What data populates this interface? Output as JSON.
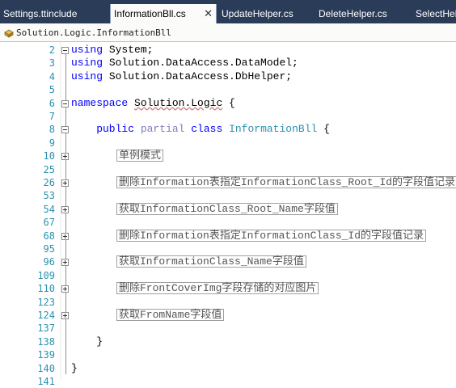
{
  "tabs": [
    {
      "label": "Settings.ttinclude",
      "active": false
    },
    {
      "label": "InformationBll.cs",
      "active": true
    },
    {
      "label": "UpdateHelper.cs",
      "active": false
    },
    {
      "label": "DeleteHelper.cs",
      "active": false
    },
    {
      "label": "SelectHel",
      "active": false
    }
  ],
  "navbar": {
    "type_name": "Solution.Logic.InformationBll"
  },
  "colors": {
    "tab_strip": "#2b3c59",
    "keyword": "#0000ff",
    "type": "#2b91af",
    "line_number": "#2b91af"
  },
  "editor": {
    "lines": [
      {
        "num": "2",
        "tokens": [
          {
            "t": "using",
            "c": "kw"
          },
          {
            "t": " System;",
            "c": "plain"
          }
        ],
        "outline": "minus"
      },
      {
        "num": "3",
        "tokens": [
          {
            "t": "using",
            "c": "kw"
          },
          {
            "t": " Solution.DataAccess.DataModel;",
            "c": "plain"
          }
        ]
      },
      {
        "num": "4",
        "tokens": [
          {
            "t": "using",
            "c": "kw"
          },
          {
            "t": " Solution.DataAccess.DbHelper;",
            "c": "plain"
          }
        ]
      },
      {
        "num": "5",
        "tokens": []
      },
      {
        "num": "6",
        "tokens": [
          {
            "t": "namespace",
            "c": "kw"
          },
          {
            "t": " ",
            "c": "plain"
          },
          {
            "t": "Solution.Logic",
            "c": "plain squig"
          },
          {
            "t": " {",
            "c": "plain"
          }
        ],
        "outline": "minus"
      },
      {
        "num": "7",
        "tokens": []
      },
      {
        "num": "8",
        "tokens": [
          {
            "t": "    public",
            "c": "kw"
          },
          {
            "t": " ",
            "c": "plain"
          },
          {
            "t": "partial",
            "c": "partial"
          },
          {
            "t": " ",
            "c": "plain"
          },
          {
            "t": "class",
            "c": "kw"
          },
          {
            "t": " ",
            "c": "plain"
          },
          {
            "t": "InformationBll",
            "c": "typ"
          },
          {
            "t": " {",
            "c": "plain"
          }
        ],
        "outline": "minus"
      },
      {
        "num": "9",
        "tokens": []
      },
      {
        "num": "10",
        "collapsed": "单例模式",
        "outline": "plus"
      },
      {
        "num": "25",
        "tokens": []
      },
      {
        "num": "26",
        "collapsed": "删除Information表指定InformationClass_Root_Id的字段值记录",
        "outline": "plus"
      },
      {
        "num": "53",
        "tokens": []
      },
      {
        "num": "54",
        "collapsed": "获取InformationClass_Root_Name字段值",
        "outline": "plus"
      },
      {
        "num": "67",
        "tokens": []
      },
      {
        "num": "68",
        "collapsed": "删除Information表指定InformationClass_Id的字段值记录",
        "outline": "plus"
      },
      {
        "num": "95",
        "tokens": []
      },
      {
        "num": "96",
        "collapsed": "获取InformationClass_Name字段值",
        "outline": "plus"
      },
      {
        "num": "109",
        "tokens": []
      },
      {
        "num": "110",
        "collapsed": "删除FrontCoverImg字段存储的对应图片",
        "outline": "plus"
      },
      {
        "num": "123",
        "tokens": []
      },
      {
        "num": "124",
        "collapsed": "获取FromName字段值",
        "outline": "plus"
      },
      {
        "num": "137",
        "tokens": []
      },
      {
        "num": "138",
        "tokens": [
          {
            "t": "    }",
            "c": "plain"
          }
        ]
      },
      {
        "num": "139",
        "tokens": []
      },
      {
        "num": "140",
        "tokens": [
          {
            "t": "}",
            "c": "plain"
          }
        ]
      },
      {
        "num": "141",
        "tokens": []
      }
    ]
  }
}
